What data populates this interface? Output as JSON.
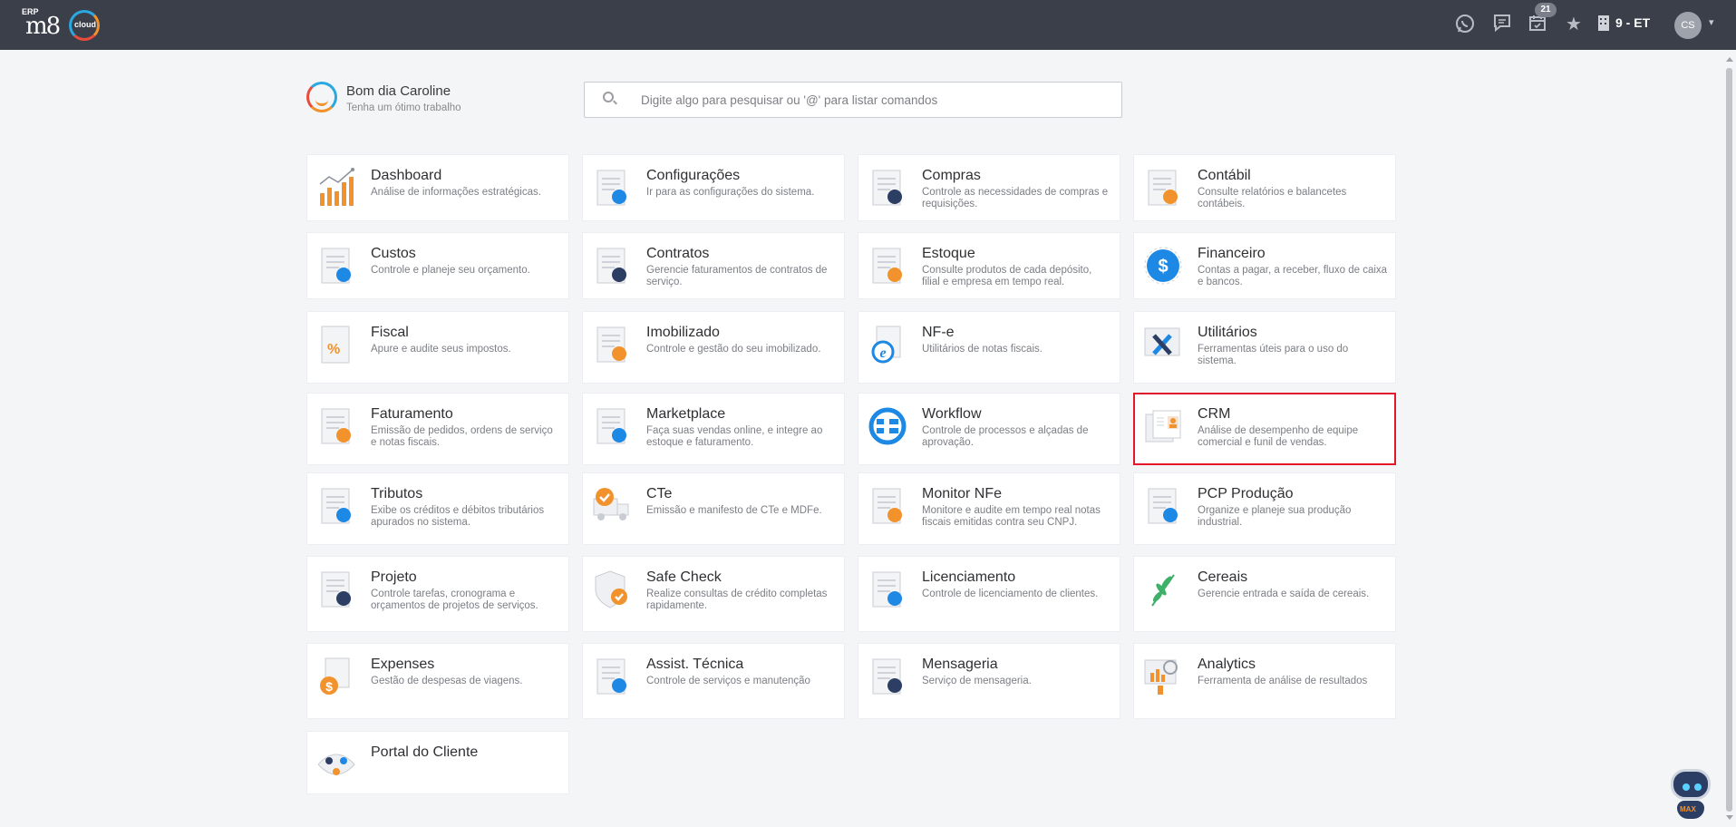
{
  "topbar": {
    "logo_prefix": "ERP",
    "logo_text": "m8",
    "logo_suffix": "cloud",
    "icons": [
      "whatsapp-icon",
      "chat-icon",
      "calendar-check-icon",
      "star-icon"
    ],
    "calendar_badge": "21",
    "company": "9 - ET",
    "avatar_initials": "CS"
  },
  "greeting": {
    "title": "Bom dia Caroline",
    "subtitle": "Tenha um ótimo trabalho"
  },
  "search": {
    "placeholder": "Digite algo para pesquisar ou '@' para listar comandos",
    "value": ""
  },
  "modules": [
    {
      "title": "Dashboard",
      "desc": "Análise de informações estratégicas.",
      "icon": "bar-chart-icon"
    },
    {
      "title": "Configurações",
      "desc": "Ir para as configurações do sistema.",
      "icon": "settings-profile-icon"
    },
    {
      "title": "Compras",
      "desc": "Controle as necessidades de compras e requisições.",
      "icon": "shopping-cart-icon"
    },
    {
      "title": "Contábil",
      "desc": "Consulte relatórios e balancetes contábeis.",
      "icon": "calculator-icon"
    },
    {
      "title": "Custos",
      "desc": "Controle e planeje seu orçamento.",
      "icon": "cost-coin-icon"
    },
    {
      "title": "Contratos",
      "desc": "Gerencie faturamentos de contratos de serviço.",
      "icon": "contract-icon"
    },
    {
      "title": "Estoque",
      "desc": "Consulte produtos de cada depósito, filial e empresa em tempo real.",
      "icon": "warehouse-icon"
    },
    {
      "title": "Financeiro",
      "desc": "Contas a pagar, a receber, fluxo de caixa e bancos.",
      "icon": "dollar-circle-icon"
    },
    {
      "title": "Fiscal",
      "desc": "Apure e audite seus impostos.",
      "icon": "percent-document-icon"
    },
    {
      "title": "Imobilizado",
      "desc": "Controle e gestão do seu imobilizado.",
      "icon": "building-icon"
    },
    {
      "title": "NF-e",
      "desc": "Utilitários de notas fiscais.",
      "icon": "e-document-icon"
    },
    {
      "title": "Utilitários",
      "desc": "Ferramentas úteis para o uso do sistema.",
      "icon": "tools-icon"
    },
    {
      "title": "Faturamento",
      "desc": "Emissão de pedidos, ordens de serviço e notas fiscais.",
      "icon": "billing-hand-icon"
    },
    {
      "title": "Marketplace",
      "desc": "Faça suas vendas online, e integre ao estoque e faturamento.",
      "icon": "handshake-network-icon"
    },
    {
      "title": "Workflow",
      "desc": "Controle de processos e alçadas de aprovação.",
      "icon": "workflow-icon"
    },
    {
      "title": "CRM",
      "desc": "Análise de desempenho de equipe comercial e funil de vendas.",
      "icon": "crm-profile-icon"
    },
    {
      "title": "Tributos",
      "desc": "Exibe os créditos e débitos tributários apurados no sistema.",
      "icon": "tax-transfer-icon"
    },
    {
      "title": "CTe",
      "desc": "Emissão e manifesto de CTe e MDFe.",
      "icon": "truck-check-icon"
    },
    {
      "title": "Monitor NFe",
      "desc": "Monitore e audite em tempo real notas fiscais emitidas contra seu CNPJ.",
      "icon": "magnifier-document-icon"
    },
    {
      "title": "PCP Produção",
      "desc": "Organize e planeje sua produção industrial.",
      "icon": "production-gear-icon"
    },
    {
      "title": "Projeto",
      "desc": "Controle tarefas, cronograma e orçamentos de projetos de serviços.",
      "icon": "project-clipboard-icon"
    },
    {
      "title": "Safe Check",
      "desc": "Realize consultas de crédito completas rapidamente.",
      "icon": "shield-check-icon"
    },
    {
      "title": "Licenciamento",
      "desc": "Controle de licenciamento de clientes.",
      "icon": "license-store-icon"
    },
    {
      "title": "Cereais",
      "desc": "Gerencie entrada e saída de cereais.",
      "icon": "grain-leaf-icon"
    },
    {
      "title": "Expenses",
      "desc": "Gestão de despesas de viagens.",
      "icon": "expense-coin-icon"
    },
    {
      "title": "Assist. Técnica",
      "desc": "Controle de serviços e manutenção",
      "icon": "gear-wrench-icon"
    },
    {
      "title": "Mensageria",
      "desc": "Serviço de mensageria.",
      "icon": "message-transfer-icon"
    },
    {
      "title": "Analytics",
      "desc": "Ferramenta de análise de resultados",
      "icon": "analytics-board-icon"
    },
    {
      "title": "Portal do Cliente",
      "desc": "",
      "icon": "client-portal-icon"
    }
  ],
  "selected_module": "CRM",
  "assistant": {
    "label": "MAX"
  }
}
